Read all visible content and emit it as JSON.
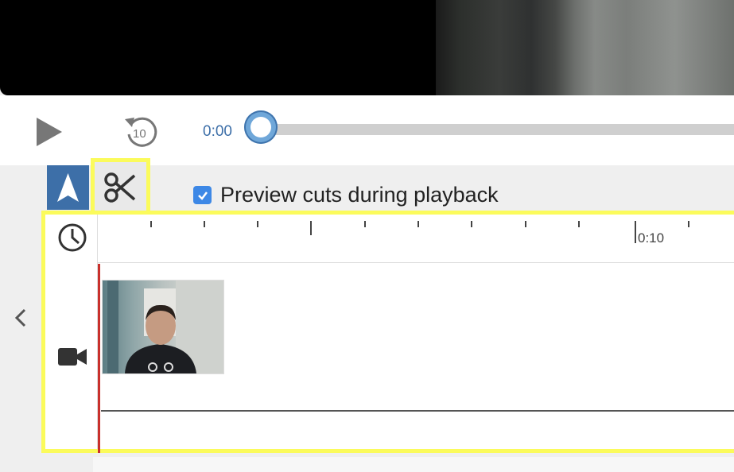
{
  "player": {
    "current_time": "0:00",
    "scrubber_position": 0
  },
  "toolbar": {
    "nav_tool_icon": "navigation-arrow-icon",
    "cut_tool_icon": "scissors-icon",
    "preview_cuts_label": "Preview cuts during playback",
    "preview_cuts_checked": true
  },
  "timeline": {
    "ruler_icon": "clock-icon",
    "track_icon": "video-camera-icon",
    "tick_label": "0:10",
    "clip_thumbnail": "webcam-clip-thumbnail"
  },
  "sidebar": {
    "collapse_icon": "chevron-left-icon"
  },
  "colors": {
    "accent": "#3d6fa8",
    "highlight": "#fbfb5b",
    "playhead": "#c9302c",
    "checkbox": "#3d88e6"
  }
}
